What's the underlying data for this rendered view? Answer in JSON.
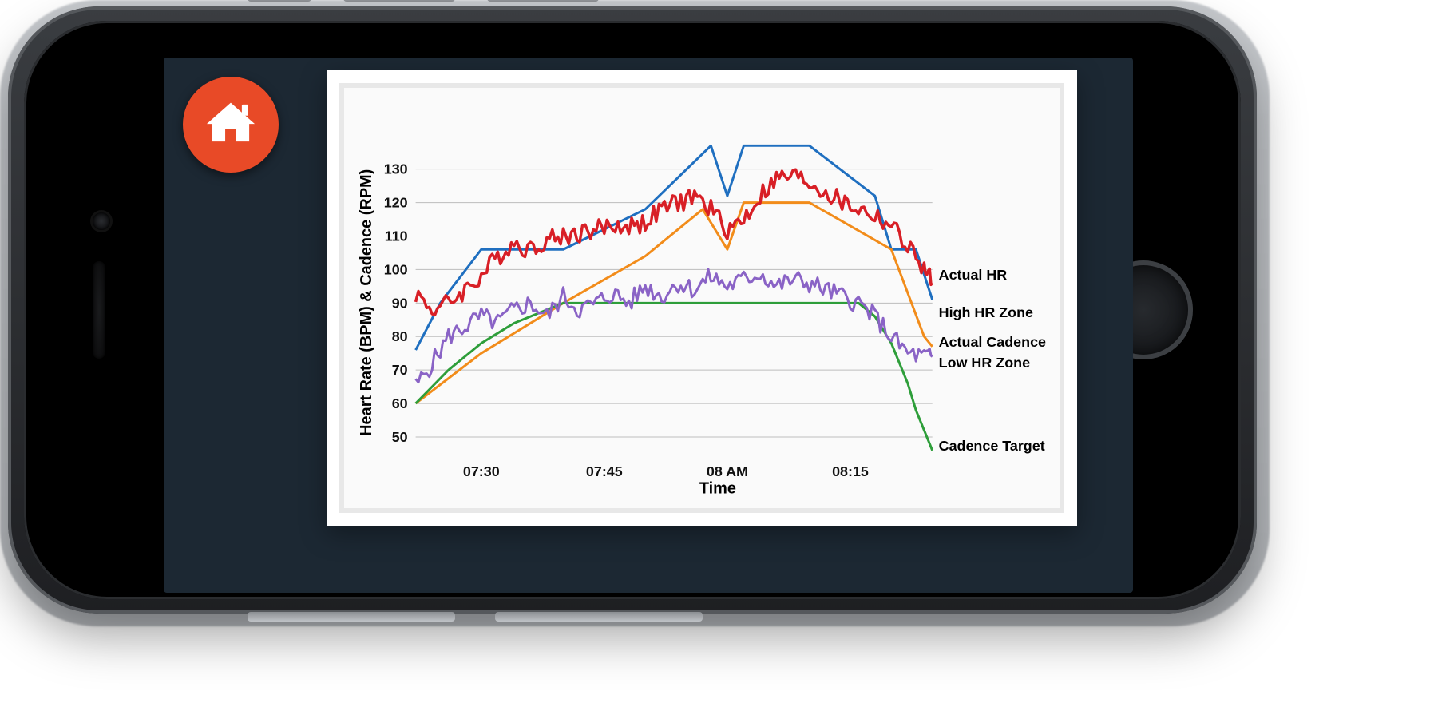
{
  "app": {
    "home_button_name": "home"
  },
  "chart_data": {
    "type": "line",
    "xlabel": "Time",
    "ylabel": "Heart Rate (BPM) & Cadence (RPM)",
    "ylim": [
      45,
      140
    ],
    "y_ticks": [
      50,
      60,
      70,
      80,
      90,
      100,
      110,
      120,
      130
    ],
    "x_ticks": [
      "07:30",
      "07:45",
      "08 AM",
      "08:15"
    ],
    "x_range_minutes": [
      22,
      85
    ],
    "x_tick_minutes": [
      30,
      45,
      60,
      75
    ],
    "legend": {
      "actual_hr": "Actual HR",
      "high_hr": "High HR Zone",
      "actual_cadence": "Actual Cadence",
      "low_hr": "Low HR Zone",
      "cadence_target": "Cadence Target"
    },
    "series": [
      {
        "name": "High HR Zone",
        "color": "#1f6fc0",
        "width": 3,
        "x": [
          22,
          25,
          30,
          40,
          50,
          58,
          60,
          62,
          70,
          78,
          80,
          83,
          85
        ],
        "y": [
          76,
          90,
          106,
          106,
          118,
          137,
          122,
          137,
          137,
          122,
          106,
          106,
          91
        ]
      },
      {
        "name": "Low HR Zone",
        "color": "#f28c1a",
        "width": 3,
        "x": [
          22,
          30,
          40,
          50,
          57,
          60,
          62,
          70,
          80,
          84,
          85
        ],
        "y": [
          60,
          75,
          90,
          104,
          118,
          106,
          120,
          120,
          106,
          80,
          77
        ]
      },
      {
        "name": "Cadence Target",
        "color": "#2e9e3a",
        "width": 3,
        "x": [
          22,
          24,
          26,
          28,
          30,
          32,
          34,
          36,
          38,
          40,
          50,
          60,
          70,
          76,
          78,
          79,
          80,
          81,
          82,
          83,
          84,
          85
        ],
        "y": [
          60,
          65,
          70,
          74,
          78,
          81,
          84,
          86,
          88,
          90,
          90,
          90,
          90,
          90,
          86,
          82,
          78,
          72,
          66,
          58,
          52,
          46
        ]
      },
      {
        "name": "Actual HR",
        "color": "#d81f26",
        "width": 3.5,
        "noisy": true,
        "x": [
          22,
          24,
          26,
          28,
          30,
          32,
          34,
          36,
          38,
          40,
          42,
          44,
          46,
          48,
          50,
          52,
          54,
          56,
          58,
          60,
          62,
          64,
          66,
          68,
          70,
          72,
          74,
          76,
          78,
          80,
          82,
          84,
          85
        ],
        "y": [
          93,
          88,
          90,
          94,
          98,
          104,
          108,
          106,
          109,
          110,
          111,
          112,
          113,
          113,
          114,
          118,
          120,
          122,
          118,
          112,
          115,
          122,
          127,
          128,
          126,
          123,
          120,
          118,
          116,
          113,
          107,
          100,
          96
        ]
      },
      {
        "name": "Actual Cadence",
        "color": "#8a63c6",
        "width": 3,
        "noisy": true,
        "x": [
          22,
          24,
          26,
          28,
          30,
          32,
          34,
          36,
          38,
          40,
          42,
          44,
          46,
          48,
          50,
          52,
          54,
          56,
          58,
          60,
          62,
          64,
          66,
          68,
          70,
          72,
          74,
          76,
          78,
          80,
          82,
          84,
          85
        ],
        "y": [
          65,
          72,
          80,
          83,
          86,
          84,
          88,
          90,
          86,
          92,
          88,
          90,
          93,
          90,
          95,
          92,
          96,
          94,
          98,
          95,
          97,
          99,
          95,
          97,
          96,
          94,
          92,
          90,
          86,
          80,
          75,
          74,
          74
        ]
      }
    ],
    "legend_anchor_y": {
      "actual_hr": 97,
      "high_hr": 91,
      "actual_cadence": 77,
      "low_hr": 76,
      "cadence_target": 46
    }
  }
}
